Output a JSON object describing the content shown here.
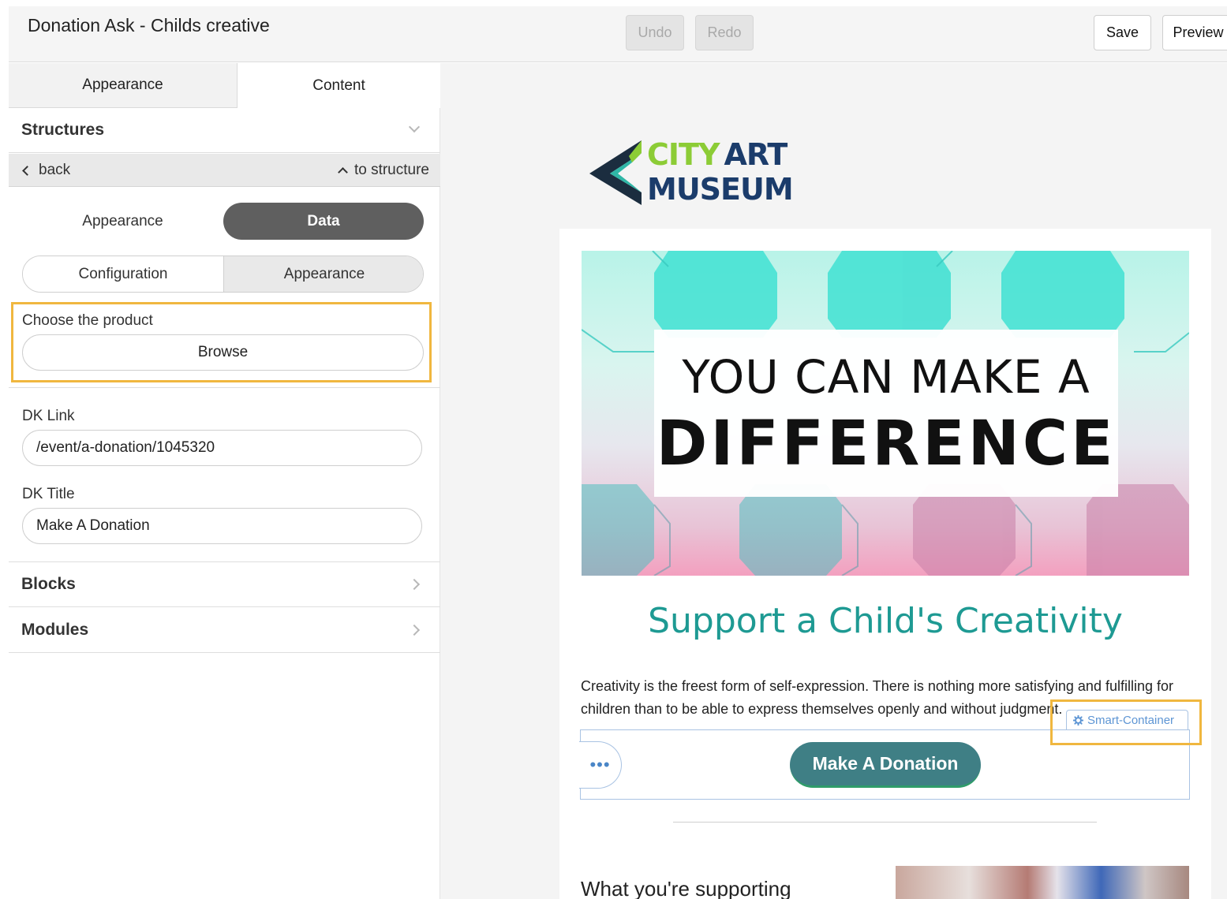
{
  "window": {
    "title": "Donation Ask - Childs creative"
  },
  "toolbar": {
    "undo": "Undo",
    "redo": "Redo",
    "save": "Save",
    "preview": "Preview"
  },
  "panel": {
    "tabs": [
      "Appearance",
      "Content"
    ],
    "structures": "Structures",
    "nav": {
      "back": "back",
      "to_structure": "to structure"
    },
    "segment1": [
      "Appearance",
      "Data"
    ],
    "segment2": [
      "Configuration",
      "Appearance"
    ],
    "product": {
      "label": "Choose the product",
      "button": "Browse"
    },
    "dk_link": {
      "label": "DK Link",
      "value": "/event/a-donation/1045320"
    },
    "dk_title": {
      "label": "DK Title",
      "value": "Make A Donation"
    },
    "blocks": "Blocks",
    "modules": "Modules"
  },
  "email": {
    "logo": {
      "line1a": "CITY",
      "line1b": "ART",
      "line2": "MUSEUM"
    },
    "hero": {
      "line1": "YOU CAN MAKE A",
      "line2": "DIFFERENCE"
    },
    "headline": "Support a Child's Creativity",
    "body": "Creativity is the freest form of self-expression. There is nothing more satisfying and fulfilling for children than to be able to express themselves openly and without judgment.",
    "smart_container": "Smart-Container",
    "more_button": "•••",
    "donate_button": "Make A Donation",
    "subheading": "What you're supporting"
  },
  "colors": {
    "accent_teal": "#1e9a93",
    "button": "#3f7f85",
    "highlight": "#f0b73f",
    "selection": "#a9c3e3"
  }
}
